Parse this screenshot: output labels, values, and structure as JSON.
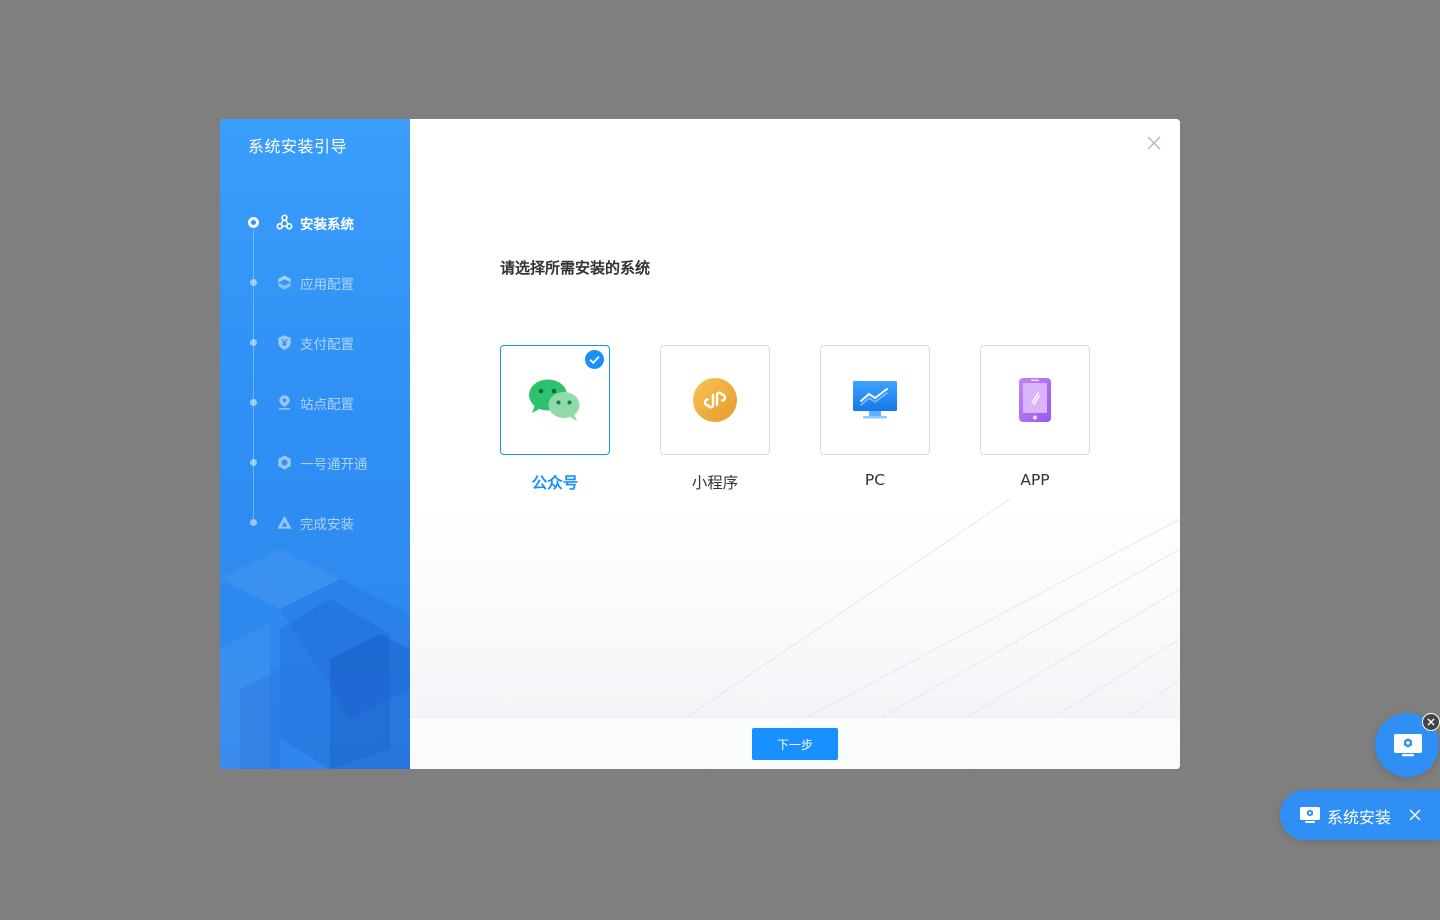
{
  "dialog": {
    "sidebar_title": "系统安装引导",
    "steps": [
      {
        "label": "安装系统",
        "icon": "nodes-icon",
        "active": true
      },
      {
        "label": "应用配置",
        "icon": "layers-icon",
        "active": false
      },
      {
        "label": "支付配置",
        "icon": "yen-shield-icon",
        "active": false
      },
      {
        "label": "站点配置",
        "icon": "location-pin-icon",
        "active": false
      },
      {
        "label": "一号通开通",
        "icon": "hex-badge-icon",
        "active": false
      },
      {
        "label": "完成安装",
        "icon": "triangle-icon",
        "active": false
      }
    ],
    "prompt": "请选择所需安装的系统",
    "options": [
      {
        "label": "公众号",
        "icon": "wechat-icon",
        "selected": true
      },
      {
        "label": "小程序",
        "icon": "mini-program-icon",
        "selected": false
      },
      {
        "label": "PC",
        "icon": "monitor-icon",
        "selected": false
      },
      {
        "label": "APP",
        "icon": "phone-icon",
        "selected": false
      }
    ],
    "next_button": "下一步"
  },
  "floating": {
    "pill_label": "系统安装"
  },
  "colors": {
    "accent": "#1890ff",
    "sidebar": "#3095f6",
    "overlay": "#7f7f7f"
  }
}
